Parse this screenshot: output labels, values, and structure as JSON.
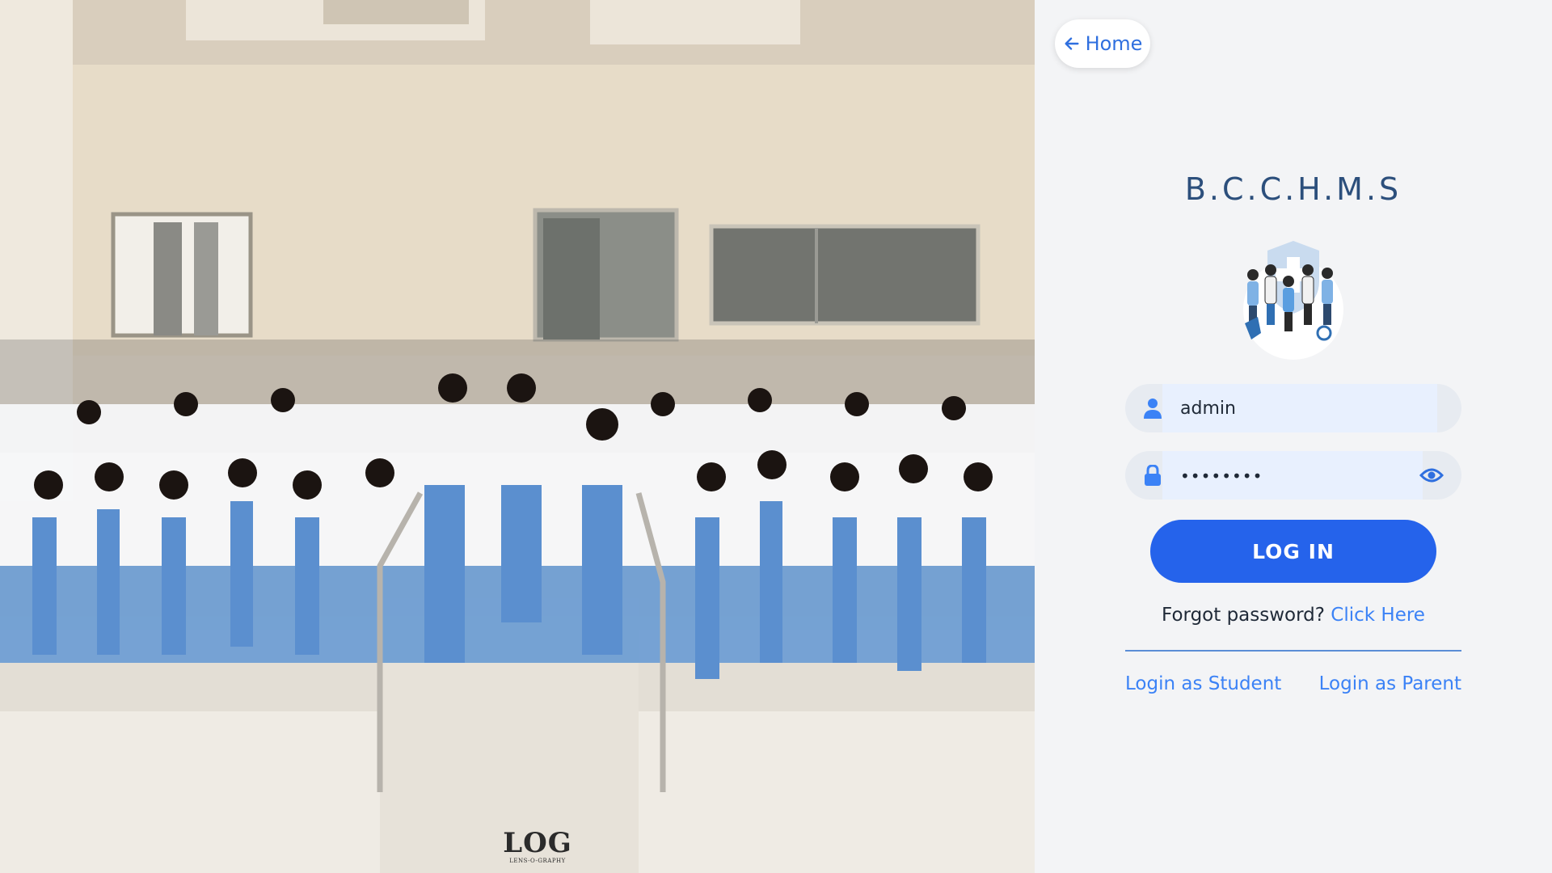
{
  "photo": {
    "alt": "Group photo of students in white coats and blue scrubs",
    "watermark_main": "LOG",
    "watermark_sub": "LENS-O-GRAPHY"
  },
  "nav": {
    "home_label": "Home",
    "home_icon": "arrow-left-icon"
  },
  "brand": {
    "name": "B.C.C.H.M.S",
    "logo_icon": "healthcare-team-icon"
  },
  "form": {
    "username": {
      "value": "admin",
      "icon": "user-icon"
    },
    "password": {
      "value": "••••••••",
      "icon": "lock-icon",
      "toggle_icon": "eye-icon"
    },
    "submit_label": "LOG IN"
  },
  "forgot": {
    "text": "Forgot password?",
    "link_label": "Click Here"
  },
  "alternates": {
    "student_label": "Login as Student",
    "parent_label": "Login as Parent"
  },
  "colors": {
    "primary": "#2563eb",
    "link": "#3b82f6",
    "brand_text": "#2c4f7c",
    "panel_bg": "#f3f4f6",
    "input_fill": "#e8f0fe"
  }
}
